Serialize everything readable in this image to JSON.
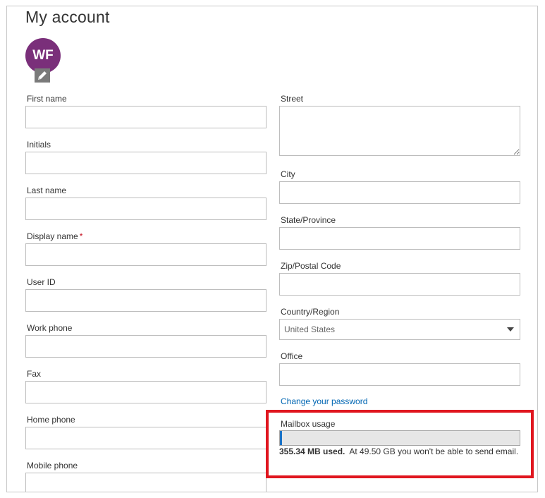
{
  "page": {
    "title": "My account"
  },
  "avatar": {
    "initials": "WF",
    "color": "#7a2f7a",
    "edit_icon": "pencil-icon"
  },
  "left_fields": [
    {
      "label": "First name",
      "value": "",
      "required": false
    },
    {
      "label": "Initials",
      "value": "",
      "required": false
    },
    {
      "label": "Last name",
      "value": "",
      "required": false
    },
    {
      "label": "Display name",
      "value": "",
      "required": true
    },
    {
      "label": "User ID",
      "value": "",
      "required": false
    },
    {
      "label": "Work phone",
      "value": "",
      "required": false
    },
    {
      "label": "Fax",
      "value": "",
      "required": false
    },
    {
      "label": "Home phone",
      "value": "",
      "required": false
    },
    {
      "label": "Mobile phone",
      "value": "",
      "required": false
    }
  ],
  "right_fields": {
    "street": {
      "label": "Street",
      "value": ""
    },
    "city": {
      "label": "City",
      "value": ""
    },
    "state": {
      "label": "State/Province",
      "value": ""
    },
    "zip": {
      "label": "Zip/Postal Code",
      "value": ""
    },
    "country": {
      "label": "Country/Region",
      "selected": "United States"
    },
    "office": {
      "label": "Office",
      "value": ""
    }
  },
  "required_marker": "*",
  "change_password": {
    "label": "Change your password",
    "color": "#0066b3"
  },
  "mailbox": {
    "label": "Mailbox usage",
    "used_text": "355.34 MB used.",
    "limit_text": "At 49.50 GB you won't be able to send email.",
    "usage_percent": 0.7,
    "bar_color": "#1a73c7",
    "highlight_color": "#e0161f"
  }
}
